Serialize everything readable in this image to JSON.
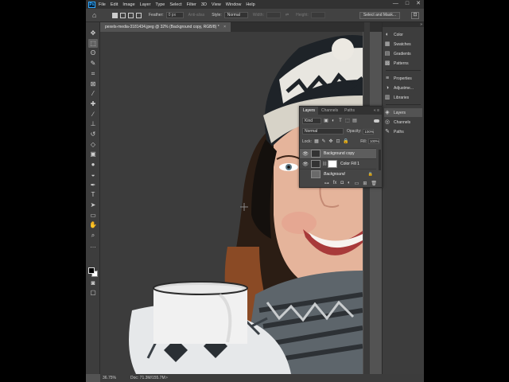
{
  "menu": {
    "logo": "Ps",
    "items": [
      "File",
      "Edit",
      "Image",
      "Layer",
      "Type",
      "Select",
      "Filter",
      "3D",
      "View",
      "Window",
      "Help"
    ],
    "window_controls": [
      "—",
      "□",
      "✕"
    ]
  },
  "options": {
    "feather_label": "Feather:",
    "feather_value": "0 px",
    "antialias_label": "Anti-alias",
    "style_label": "Style:",
    "style_value": "Normal",
    "width_label": "Width:",
    "height_label": "Height:",
    "select_mask_button": "Select and Mask..."
  },
  "document": {
    "tab_title": "pexels-media-3181434.jpeg @ 32% (Background copy, RGB/8) *",
    "tab_close": "×"
  },
  "status": {
    "zoom": "36.75%",
    "doc_info": "Doc: 71.3M/155.7M",
    "arrow": ">"
  },
  "toolbar": {
    "tools": [
      {
        "name": "move-tool-icon",
        "glyph": "✥"
      },
      {
        "name": "marquee-tool-icon",
        "glyph": "⬚"
      },
      {
        "name": "lasso-tool-icon",
        "glyph": "ʘ"
      },
      {
        "name": "quick-select-tool-icon",
        "glyph": "✎"
      },
      {
        "name": "crop-tool-icon",
        "glyph": "⌗"
      },
      {
        "name": "frame-tool-icon",
        "glyph": "⊠"
      },
      {
        "name": "eyedropper-tool-icon",
        "glyph": "⁄"
      },
      {
        "name": "healing-brush-tool-icon",
        "glyph": "✚"
      },
      {
        "name": "brush-tool-icon",
        "glyph": "∕"
      },
      {
        "name": "clone-stamp-tool-icon",
        "glyph": "⊥"
      },
      {
        "name": "history-brush-tool-icon",
        "glyph": "↺"
      },
      {
        "name": "eraser-tool-icon",
        "glyph": "◇"
      },
      {
        "name": "gradient-tool-icon",
        "glyph": "▣"
      },
      {
        "name": "blur-tool-icon",
        "glyph": "●"
      },
      {
        "name": "dodge-tool-icon",
        "glyph": "◒"
      },
      {
        "name": "pen-tool-icon",
        "glyph": "✒"
      },
      {
        "name": "type-tool-icon",
        "glyph": "T"
      },
      {
        "name": "path-select-tool-icon",
        "glyph": "➤"
      },
      {
        "name": "rectangle-tool-icon",
        "glyph": "▭"
      },
      {
        "name": "hand-tool-icon",
        "glyph": "✋"
      },
      {
        "name": "zoom-tool-icon",
        "glyph": "⌕"
      },
      {
        "name": "more-tools-icon",
        "glyph": "…"
      }
    ]
  },
  "dock": {
    "collapse": "»",
    "items": [
      {
        "label": "Color",
        "icon": "◐",
        "name": "color-panel-icon"
      },
      {
        "label": "Swatches",
        "icon": "▦",
        "name": "swatches-panel-icon"
      },
      {
        "label": "Gradients",
        "icon": "▤",
        "name": "gradients-panel-icon"
      },
      {
        "label": "Patterns",
        "icon": "▩",
        "name": "patterns-panel-icon"
      },
      {
        "label": "Properties",
        "icon": "≡",
        "name": "properties-panel-icon"
      },
      {
        "label": "Adjustme...",
        "icon": "◑",
        "name": "adjustments-panel-icon"
      },
      {
        "label": "Libraries",
        "icon": "▥",
        "name": "libraries-panel-icon"
      },
      {
        "label": "Layers",
        "icon": "◈",
        "name": "layers-panel-icon"
      },
      {
        "label": "Channels",
        "icon": "◎",
        "name": "channels-panel-icon"
      },
      {
        "label": "Paths",
        "icon": "✎",
        "name": "paths-panel-icon"
      }
    ]
  },
  "layers_panel": {
    "tabs": [
      "Layers",
      "Channels",
      "Paths"
    ],
    "tab_controls": "« ≡",
    "kind": "Kind",
    "blend_mode": "Normal",
    "opacity_label": "Opacity:",
    "opacity_value": "100%",
    "lock_label": "Lock:",
    "fill_label": "Fill:",
    "fill_value": "100%",
    "layers": [
      {
        "name": "Background copy",
        "visible": true,
        "selected": true
      },
      {
        "name": "Color Fill 1",
        "visible": true,
        "selected": false
      },
      {
        "name": "Background",
        "visible": false,
        "selected": false
      }
    ],
    "bottom_icons": [
      "⊶",
      "fx",
      "◘",
      "◐",
      "▭",
      "⊞",
      "🗑"
    ]
  },
  "colors": {
    "app_bg": "#535353",
    "menubar": "#323232",
    "panel": "#3d3d3d",
    "accent_ps": "#31a8ff",
    "canvas_bg": "#3c3c3c"
  }
}
